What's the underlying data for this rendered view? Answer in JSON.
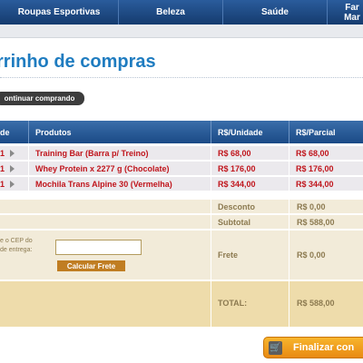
{
  "nav": {
    "items": [
      "Roupas Esportivas",
      "Beleza",
      "Saúde"
    ],
    "partial_item": [
      "Far",
      "Mar"
    ]
  },
  "page": {
    "title": "rrinho de compras",
    "continue_label": "ontinuar comprando"
  },
  "table": {
    "headers": {
      "qty": "de",
      "product": "Produtos",
      "unit": "R$/Unidade",
      "partial": "R$/Parcial"
    },
    "rows": [
      {
        "qty": "1",
        "product": "Training Bar (Barra p/ Treino)",
        "unit": "R$ 68,00",
        "partial": "R$ 68,00"
      },
      {
        "qty": "1",
        "product": "Whey Protein x 2277 g (Chocolate)",
        "unit": "R$ 176,00",
        "partial": "R$ 176,00"
      },
      {
        "qty": "1",
        "product": "Mochila Trans Alpine 30 (Vermelha)",
        "unit": "R$ 344,00",
        "partial": "R$ 344,00"
      }
    ]
  },
  "summary": {
    "discount_label": "Desconto",
    "discount_value": "R$ 0,00",
    "subtotal_label": "Subtotal",
    "subtotal_value": "R$ 588,00",
    "freight_label": "Frete",
    "freight_value": "R$ 0,00",
    "cep_label_line1": "e o CEP do",
    "cep_label_line2": "de entrega:",
    "cep_value": "",
    "calc_label": "Calcular Frete",
    "total_label": "TOTAL:",
    "total_value": "R$ 588,00"
  },
  "checkout": {
    "finish_label": "Finalizar con"
  },
  "colors": {
    "nav": "#1d4a85",
    "title": "#1f7cc0",
    "price": "#c0151c",
    "summary_bg": "#f2ebd9",
    "total_bg": "#eedcab",
    "finish": "#f0a020"
  }
}
